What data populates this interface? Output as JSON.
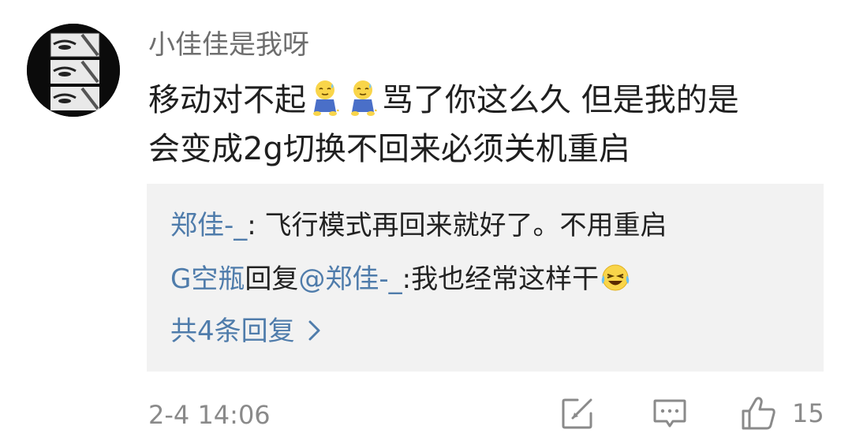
{
  "comment": {
    "username": "小佳佳是我呀",
    "text_line1_part1": "移动对不起",
    "text_line1_part2": "骂了你这么久 但是我的是",
    "text_line2": "会变成2g切换不回来必须关机重启",
    "emoji": "kneeling-sweat-emoji"
  },
  "replies": [
    {
      "author": "郑佳-_",
      "separator": ": ",
      "text": "飞行模式再回来就好了。不用重启"
    },
    {
      "author": "G空瓶",
      "verb": "回复",
      "mention": "@郑佳-_",
      "text": ":我也经常这样干",
      "emoji": "laughing-crying-emoji"
    }
  ],
  "more_replies_label": "共4条回复",
  "footer": {
    "time": "2-4 14:06",
    "like_count": "15"
  },
  "colors": {
    "link": "#4f7cab",
    "reply_bg": "#f2f2f2",
    "muted": "#8a8a8a",
    "username": "#6e6e6e"
  },
  "icons": [
    "share-icon",
    "comment-icon",
    "thumbs-up-icon",
    "chevron-right-icon"
  ]
}
